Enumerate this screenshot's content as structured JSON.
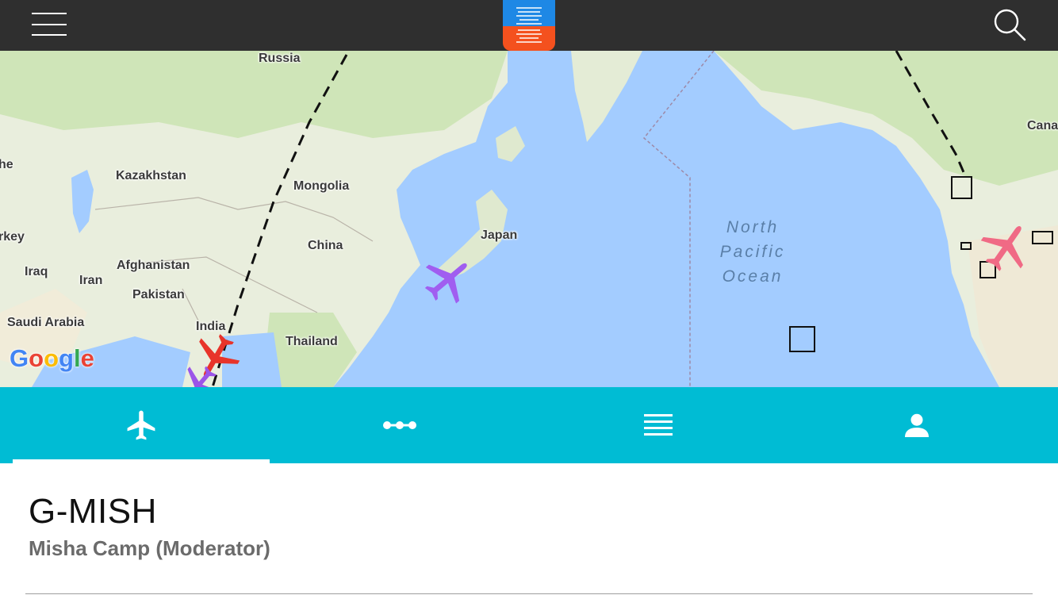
{
  "app": {
    "logo_icon": "infinite-flight-logo",
    "colors": {
      "header": "#2f2f2f",
      "logo_top": "#1e88e5",
      "logo_bottom": "#f4511e",
      "tabbar": "#00bcd4"
    }
  },
  "header": {
    "menu_icon": "hamburger-menu-icon",
    "search_icon": "search-icon"
  },
  "map": {
    "labels": {
      "russia": "Russia",
      "kazakhstan": "Kazakhstan",
      "mongolia": "Mongolia",
      "china": "China",
      "japan": "Japan",
      "afghanistan": "Afghanistan",
      "iraq": "Iraq",
      "iran": "Iran",
      "pakistan": "Pakistan",
      "saudi_arabia": "Saudi Arabia",
      "india": "India",
      "thailand": "Thailand",
      "turkey_partial": "rkey",
      "canada_partial": "Cana",
      "left_partial": "he"
    },
    "ocean": {
      "line1": "North",
      "line2": "Pacific",
      "line3": "Ocean"
    },
    "attribution": "Google"
  },
  "tabs": [
    {
      "name": "flights",
      "icon": "airplane-icon",
      "selected": true
    },
    {
      "name": "routes",
      "icon": "route-icon",
      "selected": false
    },
    {
      "name": "list",
      "icon": "list-icon",
      "selected": false
    },
    {
      "name": "profile",
      "icon": "person-icon",
      "selected": false
    }
  ],
  "details": {
    "callsign": "G-MISH",
    "pilot": "Misha Camp (Moderator)"
  }
}
